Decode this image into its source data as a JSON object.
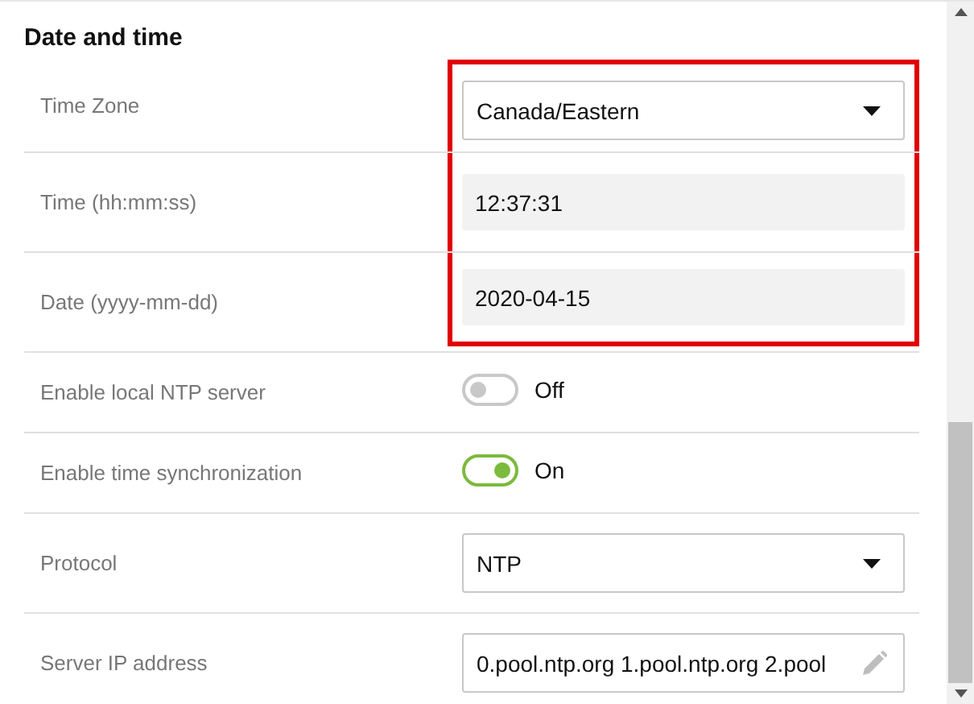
{
  "section": {
    "title": "Date and time"
  },
  "rows": [
    {
      "label": "Time Zone",
      "kind": "select",
      "value": "Canada/Eastern",
      "highlighted": true
    },
    {
      "label": "Time (hh:mm:ss)",
      "kind": "readonly",
      "value": "12:37:31",
      "highlighted": true
    },
    {
      "label": "Date (yyyy-mm-dd)",
      "kind": "readonly",
      "value": "2020-04-15",
      "highlighted": true
    },
    {
      "label": "Enable local NTP server",
      "kind": "toggle",
      "on": false,
      "state_label": "Off",
      "highlighted": false
    },
    {
      "label": "Enable time synchronization",
      "kind": "toggle",
      "on": true,
      "state_label": "On",
      "highlighted": false
    },
    {
      "label": "Protocol",
      "kind": "select",
      "value": "NTP",
      "highlighted": false
    },
    {
      "label": "Server IP address",
      "kind": "input",
      "value": "0.pool.ntp.org 1.pool.ntp.org 2.pool",
      "highlighted": false
    }
  ]
}
